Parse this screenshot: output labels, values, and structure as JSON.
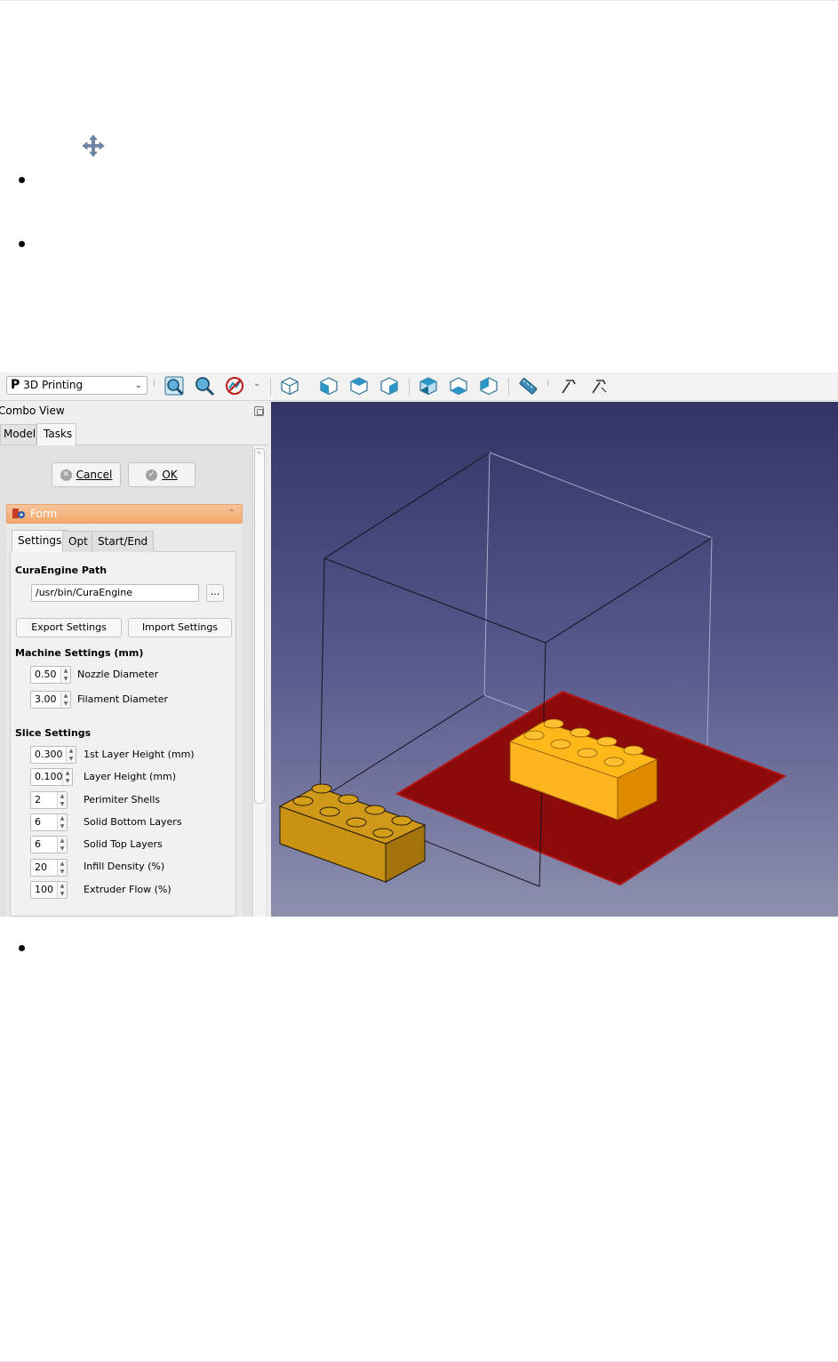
{
  "workbench": {
    "name": "3D Printing",
    "logo_letter": "P"
  },
  "toolbar": {
    "icons": [
      "fit-all-icon",
      "fit-selection-icon",
      "draw-style-icon",
      "isometric-view-icon",
      "front-view-icon",
      "top-view-icon",
      "right-view-icon",
      "rear-view-icon",
      "bottom-view-icon",
      "left-view-icon",
      "measure-icon",
      "mesh-tool-icon",
      "mesh-tool-2-icon"
    ]
  },
  "combo_view": {
    "title": "Combo View",
    "tabs": [
      "Model",
      "Tasks"
    ],
    "active_tab": "Tasks"
  },
  "dialog": {
    "cancel_label": "Cancel",
    "ok_label": "OK"
  },
  "form": {
    "title": "Form",
    "tabs": [
      "Settings",
      "Opt",
      "Start/End"
    ],
    "active_tab": "Settings",
    "engine_path_label": "CuraEngine Path",
    "engine_path_value": "/usr/bin/CuraEngine",
    "browse_label": "...",
    "export_label": "Export Settings",
    "import_label": "Import Settings",
    "machine_section": "Machine Settings (mm)",
    "machine": [
      {
        "value": "0.50",
        "label": "Nozzle Diameter"
      },
      {
        "value": "3.00",
        "label": "Filament Diameter"
      }
    ],
    "slice_section": "Slice Settings",
    "slice": [
      {
        "value": "0.300",
        "label": "1st Layer Height (mm)"
      },
      {
        "value": "0.100",
        "label": "Layer Height (mm)"
      },
      {
        "value": "2",
        "label": "Perimiter Shells"
      },
      {
        "value": "6",
        "label": "Solid Bottom Layers"
      },
      {
        "value": "6",
        "label": "Solid Top Layers"
      },
      {
        "value": "20",
        "label": "Infill Density (%)"
      },
      {
        "value": "100",
        "label": "Extruder Flow (%)"
      }
    ]
  },
  "colors": {
    "bed": "#8b0a0a",
    "brick_selected": "#ffaa00",
    "brick_other": "#c8900a",
    "form_header": "#f3a76a"
  }
}
